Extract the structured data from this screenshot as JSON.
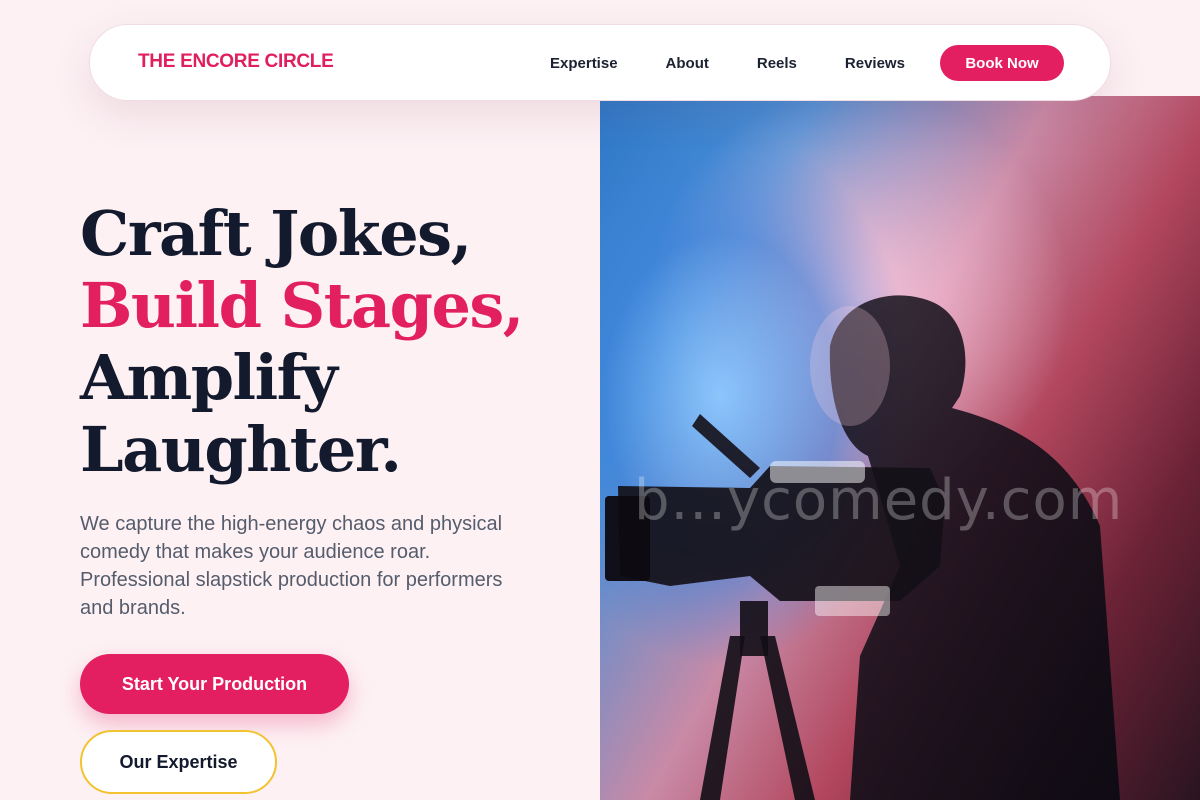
{
  "nav": {
    "brand": "THE ENCORE CIRCLE",
    "links": [
      "Expertise",
      "About",
      "Reels",
      "Reviews"
    ],
    "cta": "Book Now"
  },
  "hero": {
    "headline": {
      "line1": "Craft Jokes,",
      "line2": "Build Stages,",
      "line3": "Amplify",
      "line4": "Laughter."
    },
    "lead": "We capture the high-energy chaos and physical comedy that makes your audience roar. Professional slapstick production for performers and brands.",
    "primary_button": "Start Your Production",
    "secondary_button": "Our Expertise",
    "watermark": "b...ycomedy.com"
  },
  "colors": {
    "accent": "#e31f62",
    "headline": "#131a2d",
    "secondary_border": "#f2c230",
    "background": "#fdf1f4"
  }
}
